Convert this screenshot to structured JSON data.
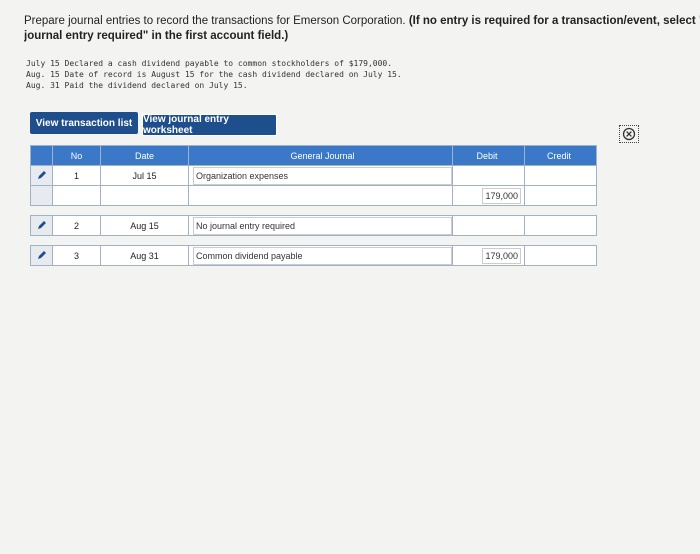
{
  "instructions": {
    "plain": "Prepare journal entries to record the transactions for Emerson Corporation.",
    "bold_line1": "(If no entry is required for a transaction/event, select \"No",
    "bold_line2": "journal entry required\" in the first account field.)"
  },
  "transactions": [
    "July 15 Declared a cash dividend payable to common stockholders of $179,000.",
    "Aug. 15 Date of record is August 15 for the cash dividend declared on July 15.",
    "Aug. 31 Paid the dividend declared on July 15."
  ],
  "buttons": {
    "view_transaction_list": "View transaction list",
    "view_journal_worksheet": "View journal entry worksheet"
  },
  "table": {
    "headers": {
      "no": "No",
      "date": "Date",
      "journal": "General Journal",
      "debit": "Debit",
      "credit": "Credit"
    },
    "rows": [
      {
        "no": "1",
        "date": "Jul 15",
        "account": "Organization expenses",
        "debit": "",
        "credit": ""
      },
      {
        "no": "",
        "date": "",
        "account": "",
        "debit": "179,000",
        "credit": ""
      },
      {
        "no": "2",
        "date": "Aug 15",
        "account": "No journal entry required",
        "debit": "",
        "credit": ""
      },
      {
        "no": "3",
        "date": "Aug 31",
        "account": "Common dividend payable",
        "debit": "179,000",
        "credit": ""
      }
    ]
  },
  "colors": {
    "header_blue": "#3b79c8",
    "button_blue": "#1f4e8c"
  },
  "icons": {
    "edit": "pencil-icon",
    "close": "close-circle-icon"
  }
}
